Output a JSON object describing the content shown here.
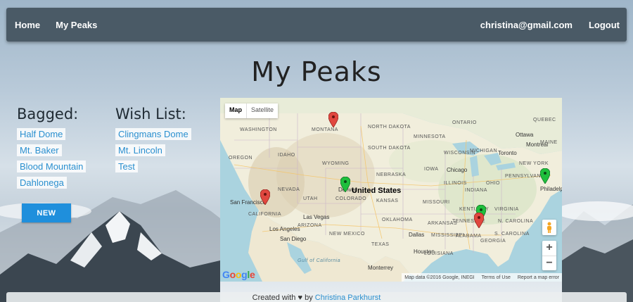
{
  "nav": {
    "home": "Home",
    "my_peaks": "My Peaks",
    "user_email": "christina@gmail.com",
    "logout": "Logout"
  },
  "page_title": "My Peaks",
  "bagged": {
    "heading": "Bagged:",
    "items": [
      "Half Dome",
      "Mt. Baker",
      "Blood Mountain",
      "Dahlonega"
    ]
  },
  "wish_list": {
    "heading": "Wish List:",
    "items": [
      "Clingmans Dome",
      "Mt. Lincoln",
      "Test"
    ]
  },
  "new_button": "NEW",
  "map": {
    "type_map": "Map",
    "type_satellite": "Satellite",
    "country_label": "United States",
    "state_labels": [
      "WASHINGTON",
      "MONTANA",
      "NORTH DAKOTA",
      "SOUTH DAKOTA",
      "MINNESOTA",
      "OREGON",
      "IDAHO",
      "WYOMING",
      "NEBRASKA",
      "IOWA",
      "NEVADA",
      "UTAH",
      "COLORADO",
      "KANSAS",
      "MISSOURI",
      "CALIFORNIA",
      "ARIZONA",
      "NEW MEXICO",
      "OKLAHOMA",
      "ARKANSAS",
      "TEXAS",
      "KENTUCKY",
      "VIRGINIA",
      "TENNESSEE",
      "N. CAROLINA",
      "S. CAROLINA",
      "GEORGIA",
      "MISSISSIPPI",
      "ALABAMA",
      "LOUISIANA",
      "ILLINOIS",
      "INDIANA",
      "OHIO",
      "MICHIGAN",
      "WISCONSIN",
      "PENNSYLVANIA",
      "NEW YORK",
      "MAINE",
      "ONTARIO",
      "QUEBEC",
      "Gulf of California"
    ],
    "city_labels": [
      "Ottawa",
      "Montreal",
      "Toronto",
      "Chicago",
      "Philadelphia",
      "San Francisco",
      "Las Vegas",
      "Los Angeles",
      "San Diego",
      "Dallas",
      "Houston",
      "Monterrey",
      "Denver"
    ],
    "attribution": [
      "Map data ©2016 Google, INEGI",
      "Terms of Use",
      "Report a map error"
    ],
    "google_logo": "Google",
    "zoom_in": "+",
    "zoom_out": "−",
    "colors": {
      "bagged_pin": "#e0473f",
      "wish_pin": "#1fbf3d"
    }
  },
  "footer": {
    "prefix": "Created with",
    "heart": "♥",
    "by": "by",
    "author": "Christina Parkhurst"
  }
}
